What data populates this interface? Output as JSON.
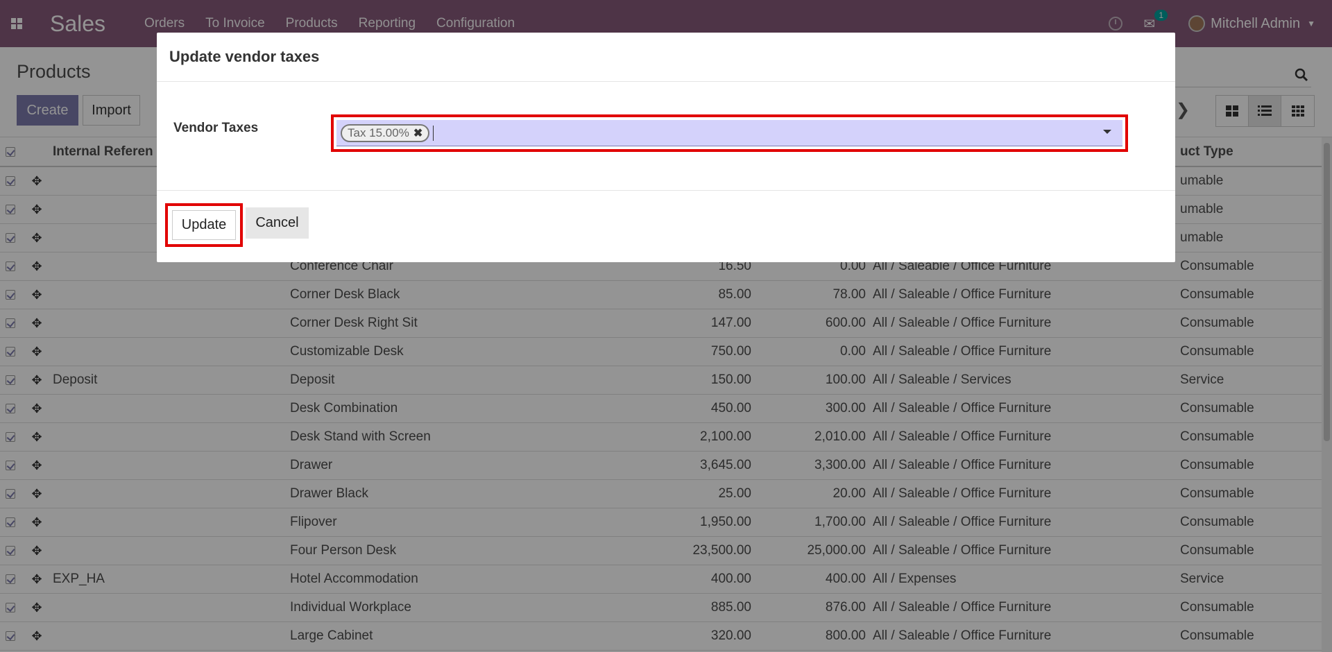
{
  "navbar": {
    "brand": "Sales",
    "menu": [
      "Orders",
      "To Invoice",
      "Products",
      "Reporting",
      "Configuration"
    ],
    "chat_count": "1",
    "user": "Mitchell Admin"
  },
  "control_panel": {
    "title": "Products",
    "create_label": "Create",
    "import_label": "Import"
  },
  "list": {
    "headers": {
      "ref": "Internal Referen",
      "type": "uct Type"
    },
    "top_rows": [
      {
        "type": "umable"
      },
      {
        "type": "umable"
      },
      {
        "type": "umable"
      }
    ],
    "rows": [
      {
        "ref": "",
        "name": "Conference Chair",
        "price": "16.50",
        "cost": "0.00",
        "categ": "All / Saleable / Office Furniture",
        "type": "Consumable"
      },
      {
        "ref": "",
        "name": "Corner Desk Black",
        "price": "85.00",
        "cost": "78.00",
        "categ": "All / Saleable / Office Furniture",
        "type": "Consumable"
      },
      {
        "ref": "",
        "name": "Corner Desk Right Sit",
        "price": "147.00",
        "cost": "600.00",
        "categ": "All / Saleable / Office Furniture",
        "type": "Consumable"
      },
      {
        "ref": "",
        "name": "Customizable Desk",
        "price": "750.00",
        "cost": "0.00",
        "categ": "All / Saleable / Office Furniture",
        "type": "Consumable"
      },
      {
        "ref": "Deposit",
        "name": "Deposit",
        "price": "150.00",
        "cost": "100.00",
        "categ": "All / Saleable / Services",
        "type": "Service"
      },
      {
        "ref": "",
        "name": "Desk Combination",
        "price": "450.00",
        "cost": "300.00",
        "categ": "All / Saleable / Office Furniture",
        "type": "Consumable"
      },
      {
        "ref": "",
        "name": "Desk Stand with Screen",
        "price": "2,100.00",
        "cost": "2,010.00",
        "categ": "All / Saleable / Office Furniture",
        "type": "Consumable"
      },
      {
        "ref": "",
        "name": "Drawer",
        "price": "3,645.00",
        "cost": "3,300.00",
        "categ": "All / Saleable / Office Furniture",
        "type": "Consumable"
      },
      {
        "ref": "",
        "name": "Drawer Black",
        "price": "25.00",
        "cost": "20.00",
        "categ": "All / Saleable / Office Furniture",
        "type": "Consumable"
      },
      {
        "ref": "",
        "name": "Flipover",
        "price": "1,950.00",
        "cost": "1,700.00",
        "categ": "All / Saleable / Office Furniture",
        "type": "Consumable"
      },
      {
        "ref": "",
        "name": "Four Person Desk",
        "price": "23,500.00",
        "cost": "25,000.00",
        "categ": "All / Saleable / Office Furniture",
        "type": "Consumable"
      },
      {
        "ref": "EXP_HA",
        "name": "Hotel Accommodation",
        "price": "400.00",
        "cost": "400.00",
        "categ": "All / Expenses",
        "type": "Service"
      },
      {
        "ref": "",
        "name": "Individual Workplace",
        "price": "885.00",
        "cost": "876.00",
        "categ": "All / Saleable / Office Furniture",
        "type": "Consumable"
      },
      {
        "ref": "",
        "name": "Large Cabinet",
        "price": "320.00",
        "cost": "800.00",
        "categ": "All / Saleable / Office Furniture",
        "type": "Consumable"
      }
    ]
  },
  "modal": {
    "title": "Update vendor taxes",
    "field_label": "Vendor Taxes",
    "tag": "Tax 15.00%",
    "update_label": "Update",
    "cancel_label": "Cancel"
  },
  "colors": {
    "navbar": "#875a7b",
    "primary": "#7c7bad",
    "highlight": "#e10000",
    "field_bg": "#d4d2fb"
  }
}
